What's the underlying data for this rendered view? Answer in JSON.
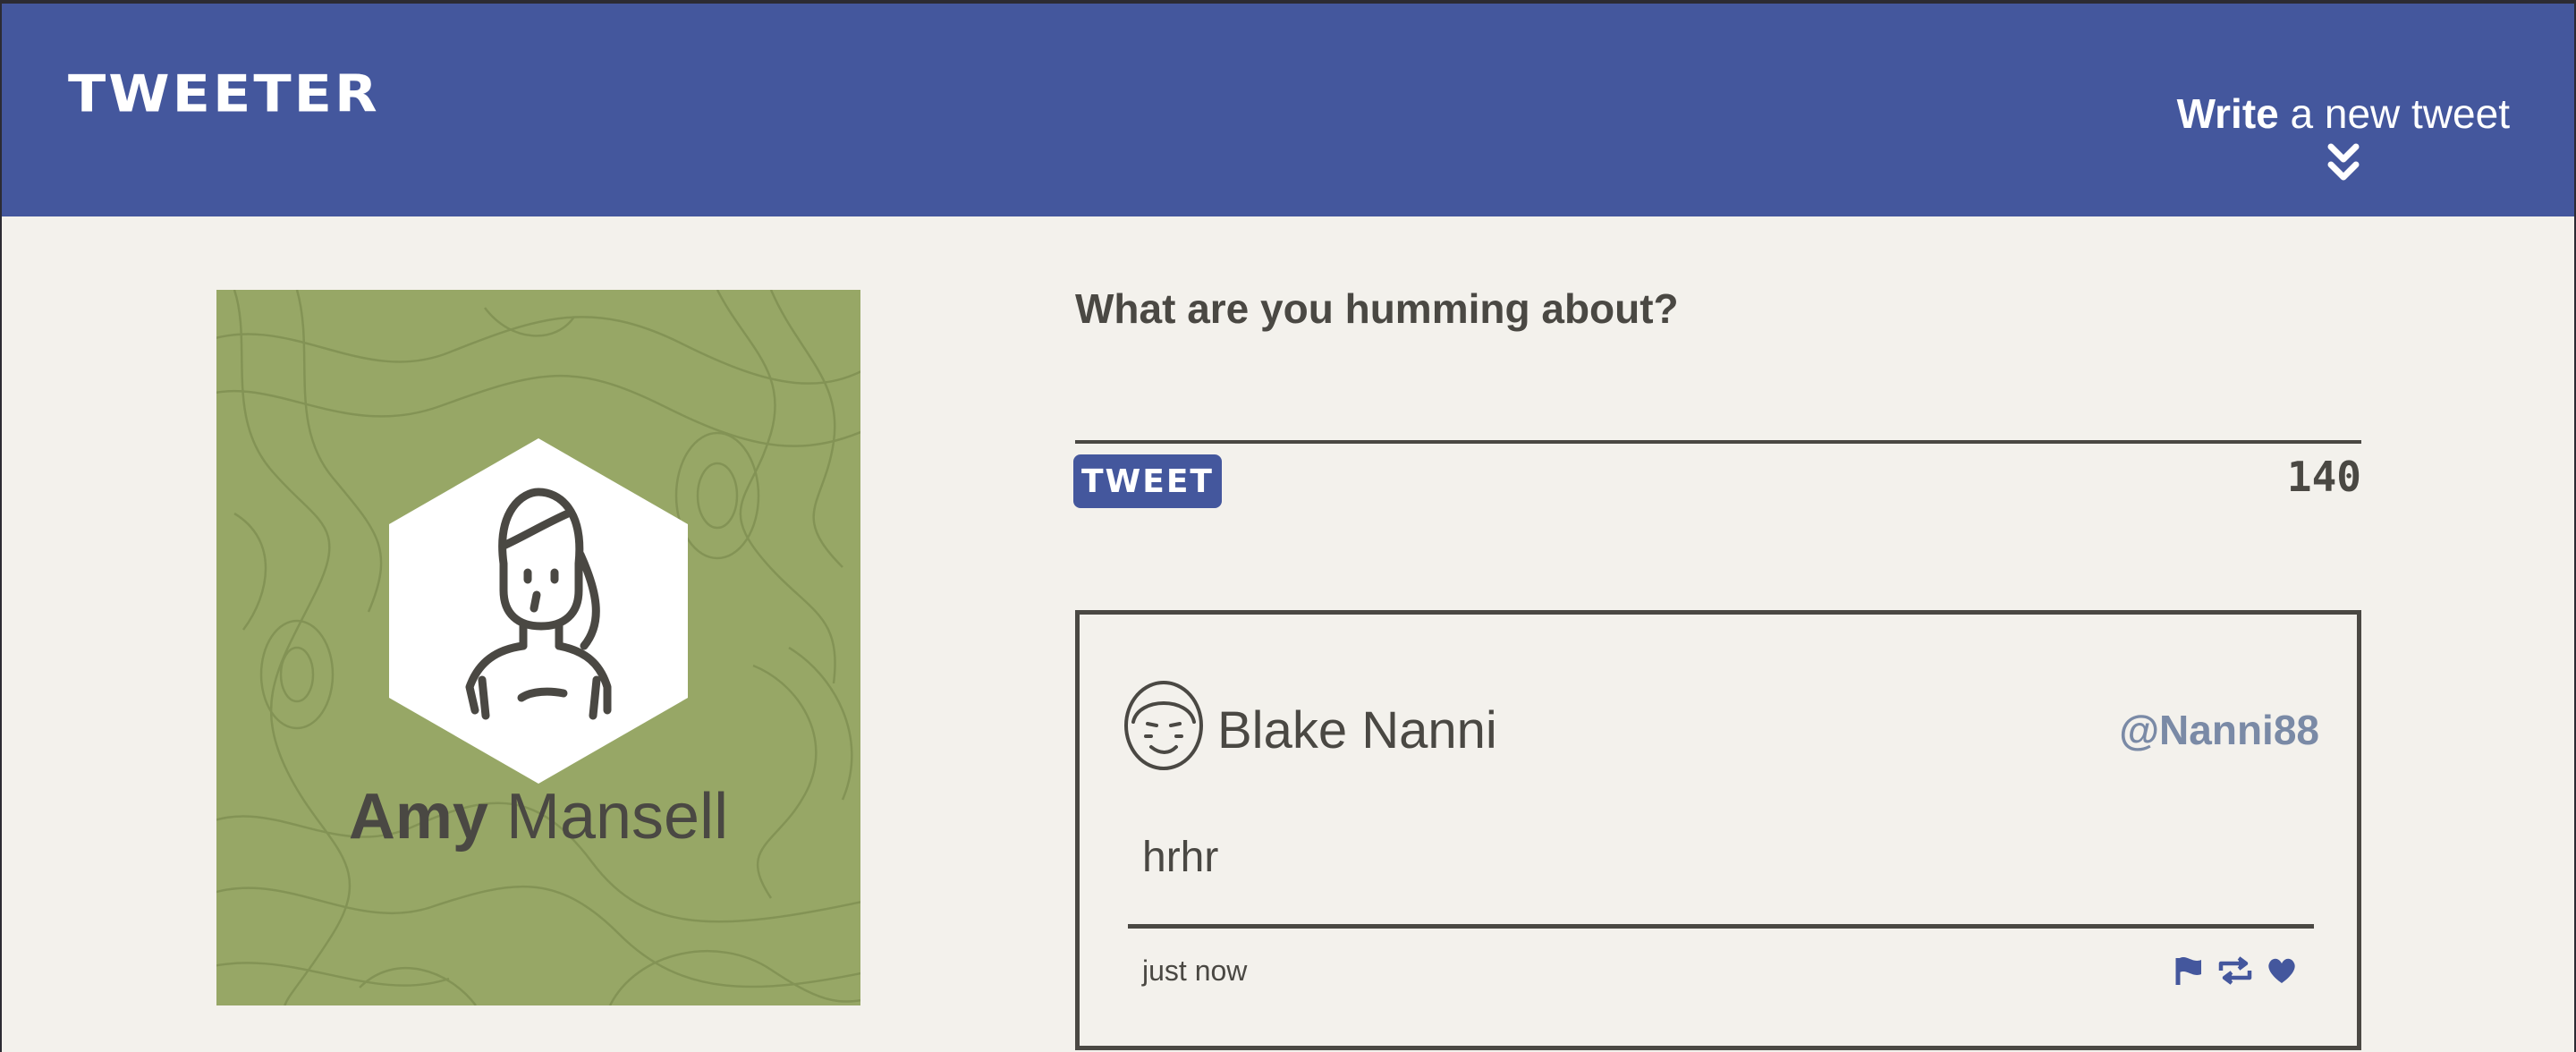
{
  "header": {
    "brand": "TWEETER",
    "compose_toggle": {
      "bold": "Write",
      "rest": " a new tweet"
    }
  },
  "profile": {
    "first_name": "Amy",
    "last_name": "Mansell"
  },
  "composer": {
    "prompt": "What are you humming about?",
    "button_label": "TWEET",
    "counter": "140"
  },
  "tweets": [
    {
      "author": "Blake Nanni",
      "handle": "@Nanni88",
      "content": "hrhr",
      "time": "just now",
      "actions": [
        "flag-icon",
        "retweet-icon",
        "heart-icon"
      ]
    }
  ],
  "colors": {
    "header_bg": "#44579d",
    "page_bg": "#f3f1ec",
    "profile_bg": "#97a766",
    "text": "#4a4843",
    "handle": "#7a8aa6"
  }
}
